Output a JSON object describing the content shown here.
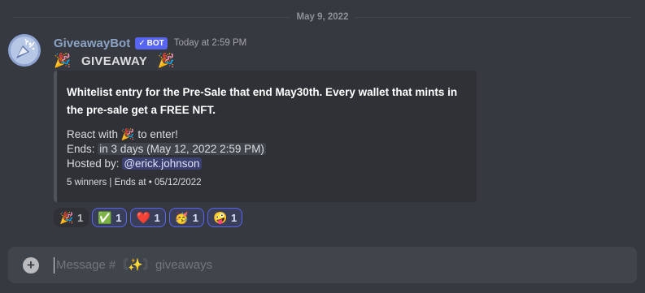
{
  "date_divider": "May 9, 2022",
  "message": {
    "username": "GiveawayBot",
    "bot_tag": "BOT",
    "timestamp": "Today at 2:59 PM",
    "title": "GIVEAWAY",
    "title_emoji": "🎉",
    "embed": {
      "description": "Whitelist entry for the Pre-Sale that end May30th.  Every wallet that mints in the pre-sale get a FREE NFT.",
      "react_prefix": "React with",
      "react_emoji": "🎉",
      "react_suffix": "to enter!",
      "ends_label": "Ends:",
      "ends_relative": "in 3 days",
      "ends_absolute": "(May 12, 2022 2:59 PM)",
      "hosted_label": "Hosted by:",
      "host": "@erick.johnson",
      "footer": "5 winners | Ends at • 05/12/2022"
    },
    "reactions": [
      {
        "emoji": "🎉",
        "count": "1",
        "me": false,
        "icon": "party-popper-icon"
      },
      {
        "emoji": "✅",
        "count": "1",
        "me": true,
        "icon": "check-mark-icon"
      },
      {
        "emoji": "❤️",
        "count": "1",
        "me": true,
        "icon": "heart-icon"
      },
      {
        "emoji": "🥳",
        "count": "1",
        "me": true,
        "icon": "party-face-icon"
      },
      {
        "emoji": "🤪",
        "count": "1",
        "me": true,
        "icon": "zany-face-icon"
      }
    ]
  },
  "composer": {
    "placeholder": "Message #〘✨〙giveaways"
  },
  "colors": {
    "background": "#36393f",
    "embed_bg": "#2f3136",
    "accent": "#5865f2",
    "username": "#8aa2c4"
  }
}
